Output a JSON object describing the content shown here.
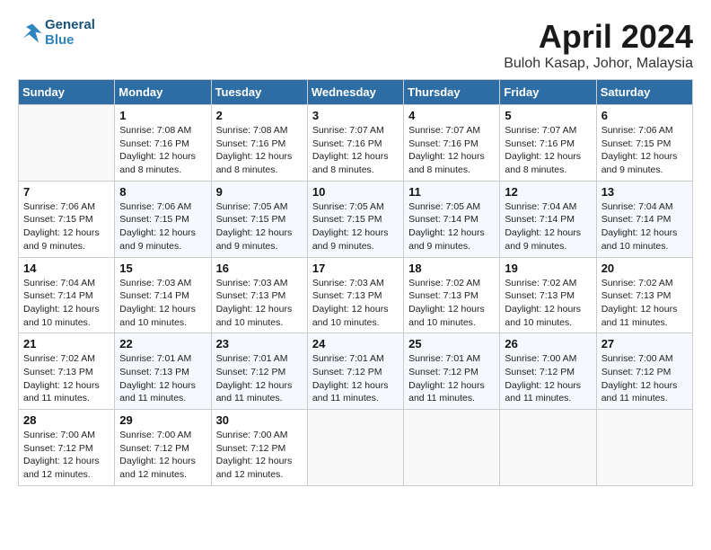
{
  "header": {
    "logo_line1": "General",
    "logo_line2": "Blue",
    "month": "April 2024",
    "location": "Buloh Kasap, Johor, Malaysia"
  },
  "weekdays": [
    "Sunday",
    "Monday",
    "Tuesday",
    "Wednesday",
    "Thursday",
    "Friday",
    "Saturday"
  ],
  "weeks": [
    [
      {
        "day": "",
        "info": ""
      },
      {
        "day": "1",
        "info": "Sunrise: 7:08 AM\nSunset: 7:16 PM\nDaylight: 12 hours\nand 8 minutes."
      },
      {
        "day": "2",
        "info": "Sunrise: 7:08 AM\nSunset: 7:16 PM\nDaylight: 12 hours\nand 8 minutes."
      },
      {
        "day": "3",
        "info": "Sunrise: 7:07 AM\nSunset: 7:16 PM\nDaylight: 12 hours\nand 8 minutes."
      },
      {
        "day": "4",
        "info": "Sunrise: 7:07 AM\nSunset: 7:16 PM\nDaylight: 12 hours\nand 8 minutes."
      },
      {
        "day": "5",
        "info": "Sunrise: 7:07 AM\nSunset: 7:16 PM\nDaylight: 12 hours\nand 8 minutes."
      },
      {
        "day": "6",
        "info": "Sunrise: 7:06 AM\nSunset: 7:15 PM\nDaylight: 12 hours\nand 9 minutes."
      }
    ],
    [
      {
        "day": "7",
        "info": "Sunrise: 7:06 AM\nSunset: 7:15 PM\nDaylight: 12 hours\nand 9 minutes."
      },
      {
        "day": "8",
        "info": "Sunrise: 7:06 AM\nSunset: 7:15 PM\nDaylight: 12 hours\nand 9 minutes."
      },
      {
        "day": "9",
        "info": "Sunrise: 7:05 AM\nSunset: 7:15 PM\nDaylight: 12 hours\nand 9 minutes."
      },
      {
        "day": "10",
        "info": "Sunrise: 7:05 AM\nSunset: 7:15 PM\nDaylight: 12 hours\nand 9 minutes."
      },
      {
        "day": "11",
        "info": "Sunrise: 7:05 AM\nSunset: 7:14 PM\nDaylight: 12 hours\nand 9 minutes."
      },
      {
        "day": "12",
        "info": "Sunrise: 7:04 AM\nSunset: 7:14 PM\nDaylight: 12 hours\nand 9 minutes."
      },
      {
        "day": "13",
        "info": "Sunrise: 7:04 AM\nSunset: 7:14 PM\nDaylight: 12 hours\nand 10 minutes."
      }
    ],
    [
      {
        "day": "14",
        "info": "Sunrise: 7:04 AM\nSunset: 7:14 PM\nDaylight: 12 hours\nand 10 minutes."
      },
      {
        "day": "15",
        "info": "Sunrise: 7:03 AM\nSunset: 7:14 PM\nDaylight: 12 hours\nand 10 minutes."
      },
      {
        "day": "16",
        "info": "Sunrise: 7:03 AM\nSunset: 7:13 PM\nDaylight: 12 hours\nand 10 minutes."
      },
      {
        "day": "17",
        "info": "Sunrise: 7:03 AM\nSunset: 7:13 PM\nDaylight: 12 hours\nand 10 minutes."
      },
      {
        "day": "18",
        "info": "Sunrise: 7:02 AM\nSunset: 7:13 PM\nDaylight: 12 hours\nand 10 minutes."
      },
      {
        "day": "19",
        "info": "Sunrise: 7:02 AM\nSunset: 7:13 PM\nDaylight: 12 hours\nand 10 minutes."
      },
      {
        "day": "20",
        "info": "Sunrise: 7:02 AM\nSunset: 7:13 PM\nDaylight: 12 hours\nand 11 minutes."
      }
    ],
    [
      {
        "day": "21",
        "info": "Sunrise: 7:02 AM\nSunset: 7:13 PM\nDaylight: 12 hours\nand 11 minutes."
      },
      {
        "day": "22",
        "info": "Sunrise: 7:01 AM\nSunset: 7:13 PM\nDaylight: 12 hours\nand 11 minutes."
      },
      {
        "day": "23",
        "info": "Sunrise: 7:01 AM\nSunset: 7:12 PM\nDaylight: 12 hours\nand 11 minutes."
      },
      {
        "day": "24",
        "info": "Sunrise: 7:01 AM\nSunset: 7:12 PM\nDaylight: 12 hours\nand 11 minutes."
      },
      {
        "day": "25",
        "info": "Sunrise: 7:01 AM\nSunset: 7:12 PM\nDaylight: 12 hours\nand 11 minutes."
      },
      {
        "day": "26",
        "info": "Sunrise: 7:00 AM\nSunset: 7:12 PM\nDaylight: 12 hours\nand 11 minutes."
      },
      {
        "day": "27",
        "info": "Sunrise: 7:00 AM\nSunset: 7:12 PM\nDaylight: 12 hours\nand 11 minutes."
      }
    ],
    [
      {
        "day": "28",
        "info": "Sunrise: 7:00 AM\nSunset: 7:12 PM\nDaylight: 12 hours\nand 12 minutes."
      },
      {
        "day": "29",
        "info": "Sunrise: 7:00 AM\nSunset: 7:12 PM\nDaylight: 12 hours\nand 12 minutes."
      },
      {
        "day": "30",
        "info": "Sunrise: 7:00 AM\nSunset: 7:12 PM\nDaylight: 12 hours\nand 12 minutes."
      },
      {
        "day": "",
        "info": ""
      },
      {
        "day": "",
        "info": ""
      },
      {
        "day": "",
        "info": ""
      },
      {
        "day": "",
        "info": ""
      }
    ]
  ]
}
